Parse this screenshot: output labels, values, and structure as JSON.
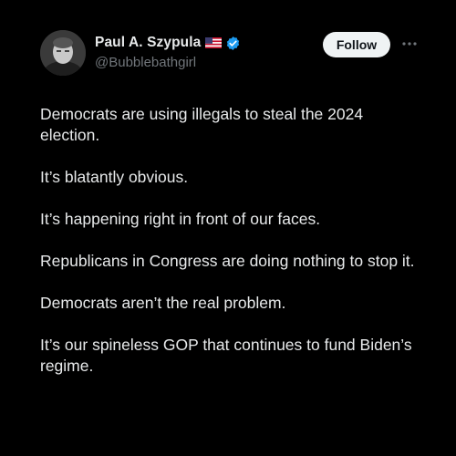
{
  "author": {
    "display_name": "Paul A. Szypula",
    "handle": "@Bubblebathgirl",
    "badges": [
      "us-flag-icon",
      "verified-badge-icon"
    ]
  },
  "actions": {
    "follow_label": "Follow",
    "more_icon": "more-horizontal-icon"
  },
  "tweet": {
    "paragraphs": [
      "Democrats are using illegals to steal the 2024 election.",
      "It’s blatantly obvious.",
      "It’s happening right in front of our faces.",
      "Republicans in Congress are doing nothing to stop it.",
      "Democrats aren’t the real problem.",
      "It’s our spineless GOP that continues to fund Biden’s regime."
    ]
  },
  "colors": {
    "background": "#000000",
    "text_primary": "#e7e9ea",
    "text_secondary": "#71767b",
    "verified_blue": "#1d9bf0",
    "follow_bg": "#eff3f4"
  }
}
